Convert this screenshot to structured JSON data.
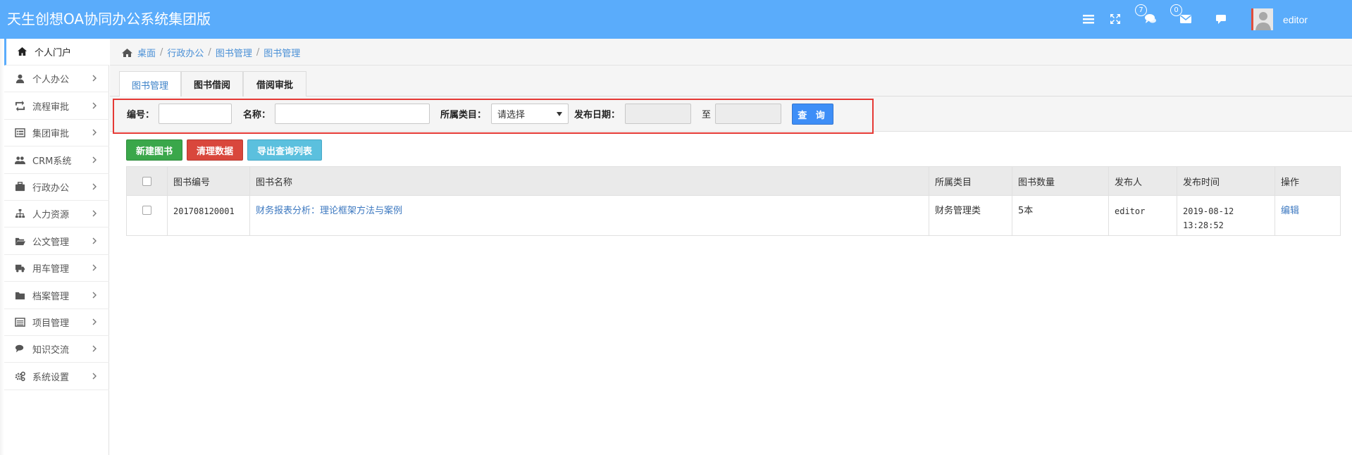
{
  "header": {
    "title": "天生创想OA协同办公系统集团版",
    "message_count": "7",
    "mail_count": "0",
    "username": "editor",
    "accent_color": "#5aacfb"
  },
  "sidebar": {
    "items": [
      {
        "label": "个人门户",
        "icon": "home-icon"
      },
      {
        "label": "个人办公",
        "icon": "user-icon"
      },
      {
        "label": "流程审批",
        "icon": "retweet-icon"
      },
      {
        "label": "集团审批",
        "icon": "list-alt-icon"
      },
      {
        "label": "CRM系统",
        "icon": "users-icon"
      },
      {
        "label": "行政办公",
        "icon": "briefcase-icon"
      },
      {
        "label": "人力资源",
        "icon": "sitemap-icon"
      },
      {
        "label": "公文管理",
        "icon": "folder-open-icon"
      },
      {
        "label": "用车管理",
        "icon": "truck-icon"
      },
      {
        "label": "档案管理",
        "icon": "folder-icon"
      },
      {
        "label": "项目管理",
        "icon": "list-icon"
      },
      {
        "label": "知识交流",
        "icon": "comments-icon"
      },
      {
        "label": "系统设置",
        "icon": "cogs-icon"
      }
    ]
  },
  "breadcrumb": {
    "items": [
      "桌面",
      "行政办公",
      "图书管理",
      "图书管理"
    ]
  },
  "tabs": [
    {
      "label": "图书管理",
      "active": true
    },
    {
      "label": "图书借阅",
      "active": false
    },
    {
      "label": "借阅审批",
      "active": false
    }
  ],
  "search": {
    "code_label": "编号：",
    "code_value": "",
    "name_label": "名称：",
    "name_value": "",
    "category_label": "所属类目：",
    "category_selected": "请选择",
    "date_label": "发布日期：",
    "date_from": "",
    "date_sep": "至",
    "date_to": "",
    "submit_label": "查 询"
  },
  "actions": {
    "new_label": "新建图书",
    "clear_label": "清理数据",
    "export_label": "导出查询列表"
  },
  "table": {
    "headers": [
      "图书编号",
      "图书名称",
      "所属类目",
      "图书数量",
      "发布人",
      "发布时间",
      "操作"
    ],
    "rows": [
      {
        "code": "201708120001",
        "name": "财务报表分析：理论框架方法与案例",
        "category": "财务管理类",
        "quantity": "5本",
        "publisher": "editor",
        "date": "2019-08-12",
        "time": "13:28:52",
        "action": "编辑"
      }
    ]
  }
}
